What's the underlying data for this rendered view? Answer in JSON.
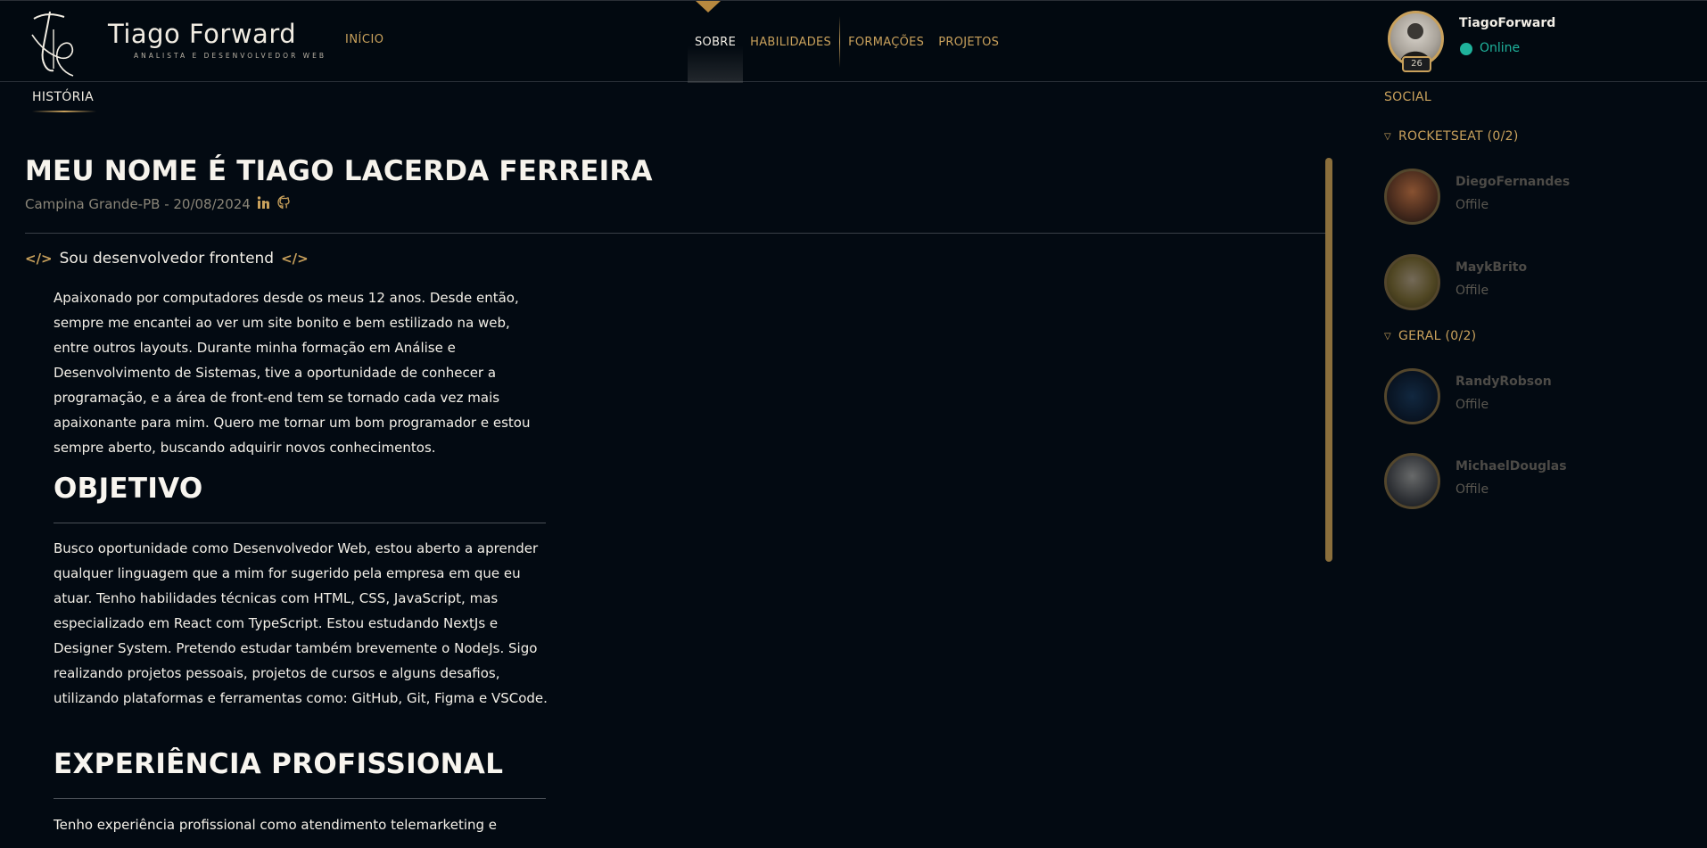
{
  "brand": {
    "name": "Tiago Forward",
    "subtitle": "ANALISTA E DESENVOLVEDOR WEB",
    "home_link": "INÍCIO"
  },
  "nav": {
    "items": [
      {
        "label": "SOBRE",
        "active": true
      },
      {
        "label": "HABILIDADES",
        "active": false
      },
      {
        "label": "FORMAÇÕES",
        "active": false
      },
      {
        "label": "PROJETOS",
        "active": false
      }
    ]
  },
  "profile": {
    "username": "TiagoForward",
    "status": "Online",
    "level": "26"
  },
  "section": {
    "tab": "HISTÓRIA",
    "social_tab": "SOCIAL"
  },
  "about": {
    "title": "MEU NOME É TIAGO LACERDA FERREIRA",
    "meta": "Campina Grande-PB - 20/08/2024",
    "dev_line": "Sou desenvolvedor frontend",
    "code_glyph": "</>",
    "intro": "Apaixonado por computadores desde os meus 12 anos. Desde então, sempre me encantei ao ver um site bonito e bem estilizado na web, entre outros layouts. Durante minha formação em Análise e Desenvolvimento de Sistemas, tive a oportunidade de conhecer a programação, e a área de front-end tem se tornado cada vez mais apaixonante para mim. Quero me tornar um bom programador e estou sempre aberto, buscando adquirir novos conhecimentos.",
    "objective_heading": "OBJETIVO",
    "objective_text": "Busco oportunidade como Desenvolvedor Web, estou aberto a aprender qualquer linguagem que a mim for sugerido pela empresa em que eu atuar. Tenho habilidades técnicas com HTML, CSS, JavaScript, mas especializado em React com TypeScript. Estou estudando NextJs e Designer System. Pretendo estudar também brevemente o NodeJs. Sigo realizando projetos pessoais, projetos de cursos e alguns desafios, utilizando plataformas e ferramentas como: GitHub, Git, Figma e VSCode.",
    "experience_heading": "EXPERIÊNCIA PROFISSIONAL",
    "experience_text": "Tenho experiência profissional como atendimento telemarketing e"
  },
  "social": {
    "groups": [
      {
        "label": "ROCKETSEAT (0/2)",
        "friends": [
          {
            "name": "DiegoFernandes",
            "status": "Offile"
          },
          {
            "name": "MaykBrito",
            "status": "Offile"
          }
        ]
      },
      {
        "label": "GERAL (0/2)",
        "friends": [
          {
            "name": "RandyRobson",
            "status": "Offile"
          },
          {
            "name": "MichaelDouglas",
            "status": "Offile"
          }
        ]
      }
    ]
  },
  "colors": {
    "accent": "#c9a15c",
    "background": "#030a12",
    "online": "#1fb39c"
  }
}
